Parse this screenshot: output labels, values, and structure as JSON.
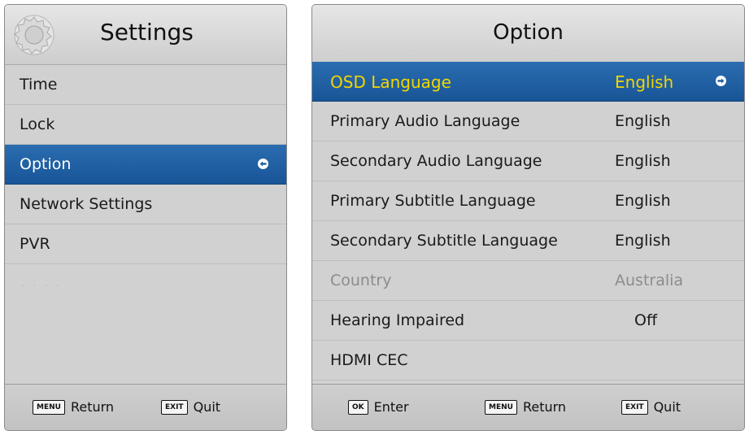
{
  "settings": {
    "title": "Settings",
    "items": [
      {
        "label": "Time"
      },
      {
        "label": "Lock"
      },
      {
        "label": "Option"
      },
      {
        "label": "Network Settings"
      },
      {
        "label": "PVR"
      }
    ],
    "footer": {
      "menu_key": "MENU",
      "menu_label": "Return",
      "exit_key": "EXIT",
      "exit_label": "Quit"
    }
  },
  "option": {
    "title": "Option",
    "items": [
      {
        "label": "OSD Language",
        "value": "English"
      },
      {
        "label": "Primary Audio Language",
        "value": "English"
      },
      {
        "label": "Secondary Audio Language",
        "value": "English"
      },
      {
        "label": "Primary Subtitle Language",
        "value": "English"
      },
      {
        "label": "Secondary Subtitle Language",
        "value": "English"
      },
      {
        "label": "Country",
        "value": "Australia"
      },
      {
        "label": "Hearing Impaired",
        "value": "Off"
      },
      {
        "label": "HDMI CEC",
        "value": ""
      }
    ],
    "footer": {
      "ok_key": "OK",
      "ok_label": "Enter",
      "menu_key": "MENU",
      "menu_label": "Return",
      "exit_key": "EXIT",
      "exit_label": "Quit"
    }
  },
  "colors": {
    "selection": "#1f62a6",
    "selected_text_option": "#f2d600",
    "panel_bg": "#d1d1d1"
  }
}
